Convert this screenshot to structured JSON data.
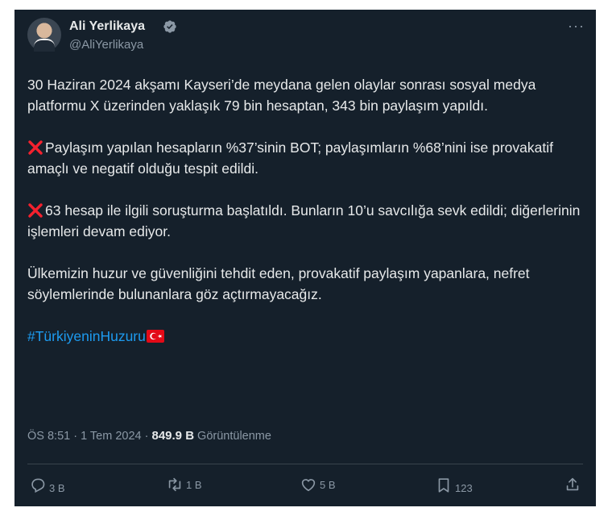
{
  "author": {
    "name": "Ali Yerlikaya",
    "handle": "@AliYerlikaya"
  },
  "tweet": {
    "paragraph1": "30 Haziran 2024 akşamı Kayseri’de meydana gelen olaylar sonrası sosyal medya platformu X üzerinden yaklaşık 79 bin hesaptan, 343 bin paylaşım yapıldı.",
    "paragraph2": "Paylaşım yapılan hesapların %37’sinin BOT; paylaşımların %68’nini ise provakatif amaçlı ve negatif olduğu tespit edildi.",
    "paragraph3": "63 hesap ile ilgili soruşturma başlatıldı. Bunların 10’u savcılığa sevk edildi; diğerlerinin işlemleri devam ediyor.",
    "paragraph4": "Ülkemizin huzur ve güvenliğini tehdit eden, provakatif paylaşım yapanlara, nefret söylemlerinde bulunanlara göz açtırmayacağız.",
    "hashtag": "#TürkiyeninHuzuru"
  },
  "meta": {
    "time": "ÖS 8:51 · 1 Tem 2024 · ",
    "views": "849.9 B",
    "views_label": " Görüntülenme"
  },
  "actions": {
    "replies": "3 B",
    "reposts": "1 B",
    "likes": "5 B",
    "bookmarks": "123"
  },
  "colors": {
    "background": "#15202b",
    "text": "#e7e9ea",
    "muted": "#8b98a5",
    "accent": "#1d9bf0",
    "cross": "#f4212e"
  },
  "icons": [
    "verified-badge-icon",
    "more-options-icon",
    "cross-mark-icon",
    "turkey-flag-icon",
    "reply-icon",
    "repost-icon",
    "like-icon",
    "bookmark-icon",
    "share-icon"
  ]
}
